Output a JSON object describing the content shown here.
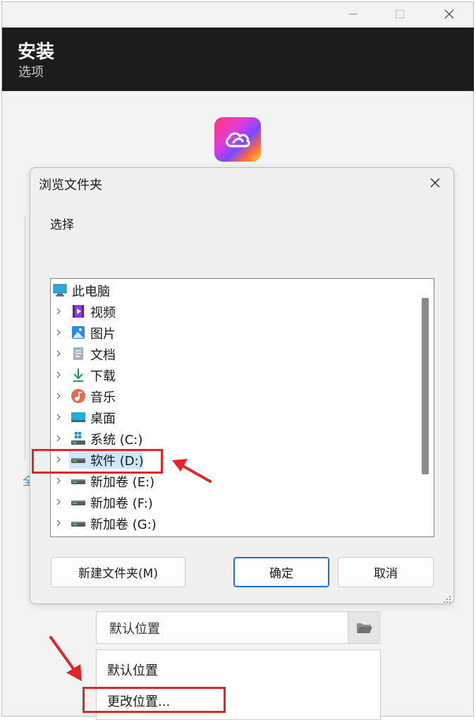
{
  "window": {
    "header_title": "安装",
    "header_subtitle": "选项",
    "caption_buttons": [
      "minimize-icon",
      "maximize-icon",
      "close-icon"
    ],
    "background_hint": "全"
  },
  "dialog": {
    "title": "浏览文件夹",
    "prompt": "选择",
    "tree": [
      {
        "label": "此电脑",
        "icon": "computer-icon",
        "expandable": false,
        "selected": false
      },
      {
        "label": "视频",
        "icon": "video-folder-icon",
        "expandable": true,
        "selected": false
      },
      {
        "label": "图片",
        "icon": "pictures-folder-icon",
        "expandable": true,
        "selected": false
      },
      {
        "label": "文档",
        "icon": "documents-folder-icon",
        "expandable": true,
        "selected": false
      },
      {
        "label": "下载",
        "icon": "download-folder-icon",
        "expandable": true,
        "selected": false
      },
      {
        "label": "音乐",
        "icon": "music-folder-icon",
        "expandable": true,
        "selected": false
      },
      {
        "label": "桌面",
        "icon": "desktop-folder-icon",
        "expandable": true,
        "selected": false
      },
      {
        "label": "系统 (C:)",
        "icon": "system-drive-icon",
        "expandable": true,
        "selected": false
      },
      {
        "label": "软件 (D:)",
        "icon": "drive-icon",
        "expandable": true,
        "selected": true
      },
      {
        "label": "新加卷 (E:)",
        "icon": "drive-icon",
        "expandable": true,
        "selected": false
      },
      {
        "label": "新加卷 (F:)",
        "icon": "drive-icon",
        "expandable": true,
        "selected": false
      },
      {
        "label": "新加卷 (G:)",
        "icon": "drive-icon",
        "expandable": true,
        "selected": false
      }
    ],
    "buttons": {
      "new_folder": "新建文件夹(M)",
      "ok": "确定",
      "cancel": "取消"
    }
  },
  "location": {
    "value": "默认位置",
    "options": [
      "默认位置",
      "更改位置..."
    ]
  },
  "colors": {
    "header_bg": "#1c1c1c",
    "selection": "#cce8ff",
    "annotation": "#e0252b",
    "ok_border": "#1e73c8"
  }
}
